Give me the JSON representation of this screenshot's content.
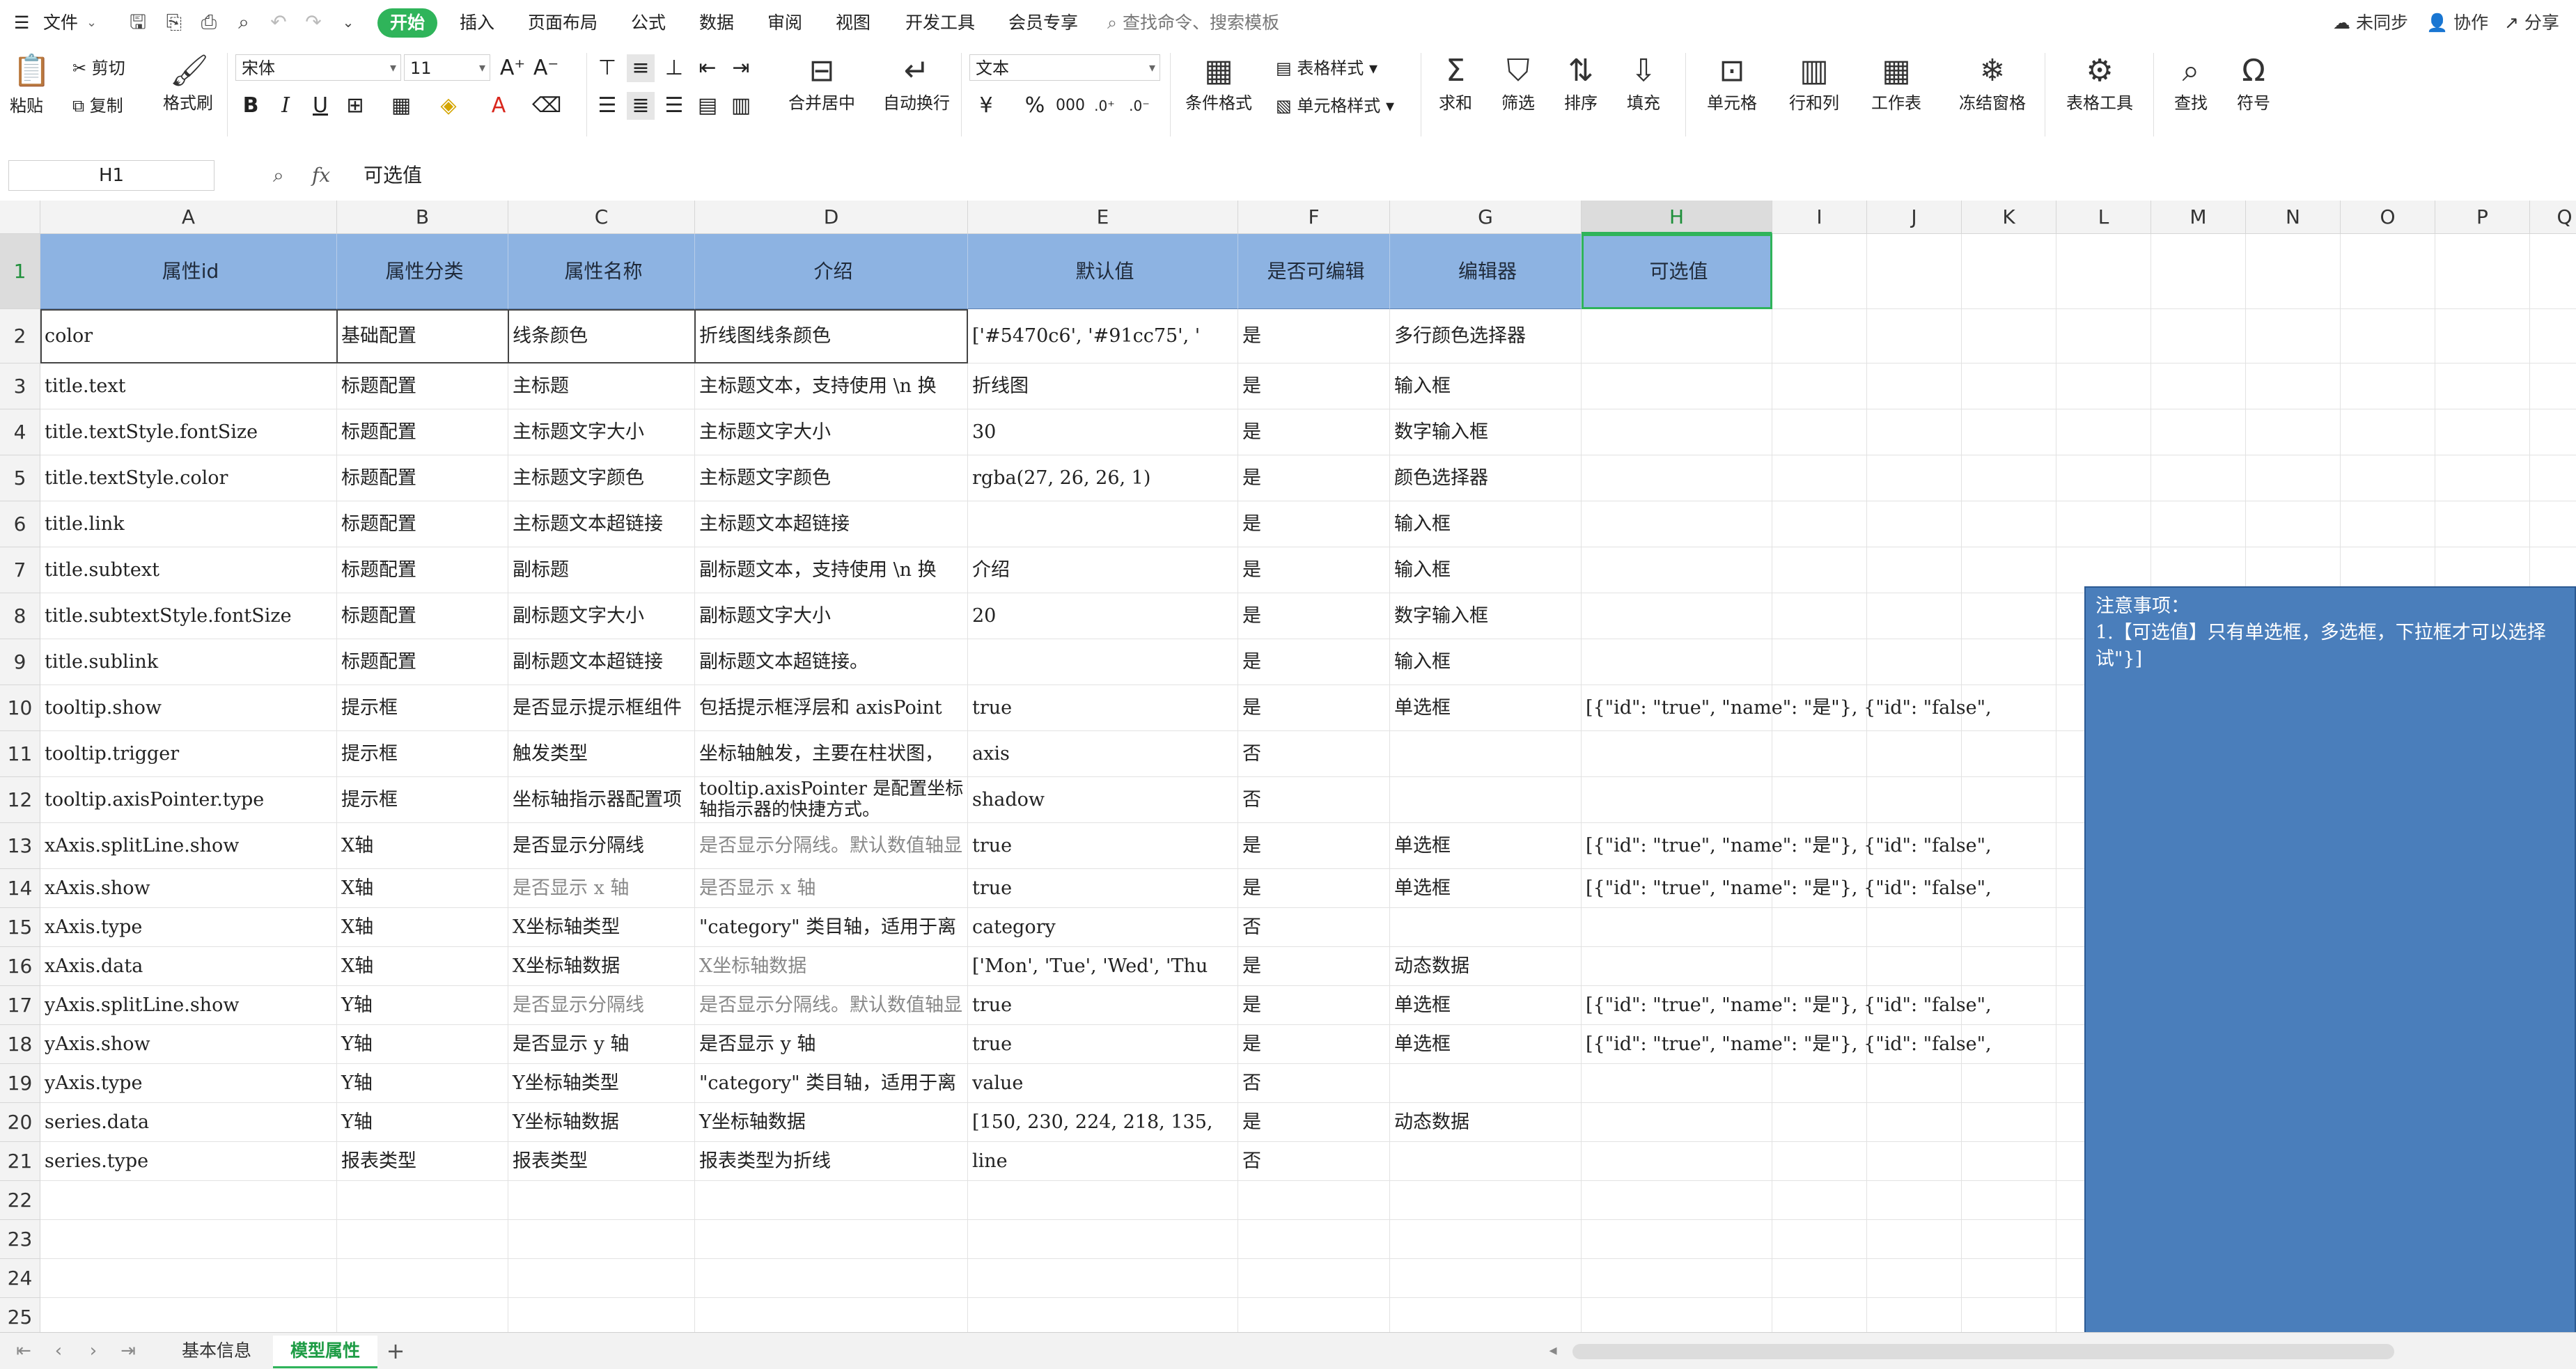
{
  "menubar": {
    "file_label": "文件",
    "tabs": [
      "开始",
      "插入",
      "页面布局",
      "公式",
      "数据",
      "审阅",
      "视图",
      "开发工具",
      "会员专享"
    ],
    "active_tab": "开始",
    "search_placeholder": "查找命令、搜索模板",
    "sync_label": "未同步",
    "collab_label": "协作",
    "share_label": "分享"
  },
  "ribbon": {
    "paste": "粘贴",
    "cut": "剪切",
    "copy": "复制",
    "format_painter": "格式刷",
    "font_name": "宋体",
    "font_size": "11",
    "merge_center": "合并居中",
    "auto_wrap": "自动换行",
    "number_format": "文本",
    "conditional_format": "条件格式",
    "table_style": "表格样式",
    "cell_style": "单元格样式",
    "sum": "求和",
    "filter": "筛选",
    "sort": "排序",
    "fill": "填充",
    "cell": "单元格",
    "row_col": "行和列",
    "worksheet": "工作表",
    "freeze": "冻结窗格",
    "table_tools": "表格工具",
    "find": "查找",
    "symbol": "符号"
  },
  "formula_bar": {
    "name_box": "H1",
    "fx": "fx",
    "content": "可选值"
  },
  "columns": [
    "A",
    "B",
    "C",
    "D",
    "E",
    "F",
    "G",
    "H",
    "I",
    "J",
    "K",
    "L",
    "M",
    "N",
    "O",
    "P",
    "Q"
  ],
  "selected_column": "H",
  "rows": [
    "1",
    "2",
    "3",
    "4",
    "5",
    "6",
    "7",
    "8",
    "9",
    "10",
    "11",
    "12",
    "13",
    "14",
    "15",
    "16",
    "17",
    "18",
    "19",
    "20",
    "21",
    "22",
    "23",
    "24",
    "25"
  ],
  "header_row": [
    "属性id",
    "属性分类",
    "属性名称",
    "介绍",
    "默认值",
    "是否可编辑",
    "编辑器",
    "可选值"
  ],
  "data_rows": [
    [
      "color",
      "基础配置",
      "线条颜色",
      "折线图线条颜色",
      "['#5470c6', '#91cc75', '",
      "是",
      "多行颜色选择器",
      ""
    ],
    [
      "title.text",
      "标题配置",
      "主标题",
      "主标题文本，支持使用 \\n 换",
      "折线图",
      "是",
      "输入框",
      ""
    ],
    [
      "title.textStyle.fontSize",
      "标题配置",
      "主标题文字大小",
      "主标题文字大小",
      "30",
      "是",
      "数字输入框",
      ""
    ],
    [
      "title.textStyle.color",
      "标题配置",
      "主标题文字颜色",
      "主标题文字颜色",
      "rgba(27, 26, 26, 1)",
      "是",
      "颜色选择器",
      ""
    ],
    [
      "title.link",
      "标题配置",
      "主标题文本超链接",
      "主标题文本超链接",
      "",
      "是",
      "输入框",
      ""
    ],
    [
      "title.subtext",
      "标题配置",
      "副标题",
      "副标题文本，支持使用 \\n 换",
      "介绍",
      "是",
      "输入框",
      ""
    ],
    [
      "title.subtextStyle.fontSize",
      "标题配置",
      "副标题文字大小",
      "副标题文字大小",
      "20",
      "是",
      "数字输入框",
      ""
    ],
    [
      "title.sublink",
      "标题配置",
      "副标题文本超链接",
      "副标题文本超链接。",
      "",
      "是",
      "输入框",
      ""
    ],
    [
      "tooltip.show",
      "提示框",
      "是否显示提示框组件",
      "包括提示框浮层和 axisPoint",
      "true",
      "是",
      "单选框",
      "[{\"id\": \"true\",  \"name\": \"是\"}, {\"id\": \"false\","
    ],
    [
      "tooltip.trigger",
      "提示框",
      "触发类型",
      "坐标轴触发，主要在柱状图，",
      "axis",
      "否",
      "",
      ""
    ],
    [
      "tooltip.axisPointer.type",
      "提示框",
      "坐标轴指示器配置项",
      "tooltip.axisPointer 是配置坐标轴指示器的快捷方式。",
      "shadow",
      "否",
      "",
      ""
    ],
    [
      "xAxis.splitLine.show",
      "X轴",
      "是否显示分隔线",
      "是否显示分隔线。默认数值轴显",
      "true",
      "是",
      "单选框",
      "[{\"id\": \"true\",  \"name\": \"是\"}, {\"id\": \"false\","
    ],
    [
      "xAxis.show",
      "X轴",
      "是否显示 x 轴",
      "是否显示 x 轴",
      "true",
      "是",
      "单选框",
      "[{\"id\": \"true\",  \"name\": \"是\"}, {\"id\": \"false\","
    ],
    [
      "xAxis.type",
      "X轴",
      "X坐标轴类型",
      "\"category\" 类目轴，适用于离",
      "category",
      "否",
      "",
      ""
    ],
    [
      "xAxis.data",
      "X轴",
      "X坐标轴数据",
      "X坐标轴数据",
      "['Mon', 'Tue', 'Wed', 'Thu",
      "是",
      "动态数据",
      ""
    ],
    [
      "yAxis.splitLine.show",
      "Y轴",
      "是否显示分隔线",
      "是否显示分隔线。默认数值轴显",
      "true",
      "是",
      "单选框",
      "[{\"id\": \"true\",  \"name\": \"是\"}, {\"id\": \"false\","
    ],
    [
      "yAxis.show",
      "Y轴",
      "是否显示 y 轴",
      "是否显示 y 轴",
      "true",
      "是",
      "单选框",
      "[{\"id\": \"true\",  \"name\": \"是\"}, {\"id\": \"false\","
    ],
    [
      "yAxis.type",
      "Y轴",
      "Y坐标轴类型",
      "\"category\" 类目轴，适用于离",
      "value",
      "否",
      "",
      ""
    ],
    [
      "series.data",
      "Y轴",
      "Y坐标轴数据",
      "Y坐标轴数据",
      "[150, 230, 224, 218, 135,",
      "是",
      "动态数据",
      ""
    ],
    [
      "series.type",
      "报表类型",
      "报表类型",
      "报表类型为折线",
      "line",
      "否",
      "",
      ""
    ]
  ],
  "note": {
    "title": "注意事项：",
    "line1": "1.【可选值】只有单选框，多选框，下拉框才可以选择",
    "line2": "试\"}]"
  },
  "sheet_tabs": [
    "基本信息",
    "模型属性"
  ],
  "active_sheet": "模型属性",
  "colors": {
    "accent": "#2fb45a",
    "header_fill": "#8db3e2",
    "note_fill": "#4a7ebb"
  }
}
